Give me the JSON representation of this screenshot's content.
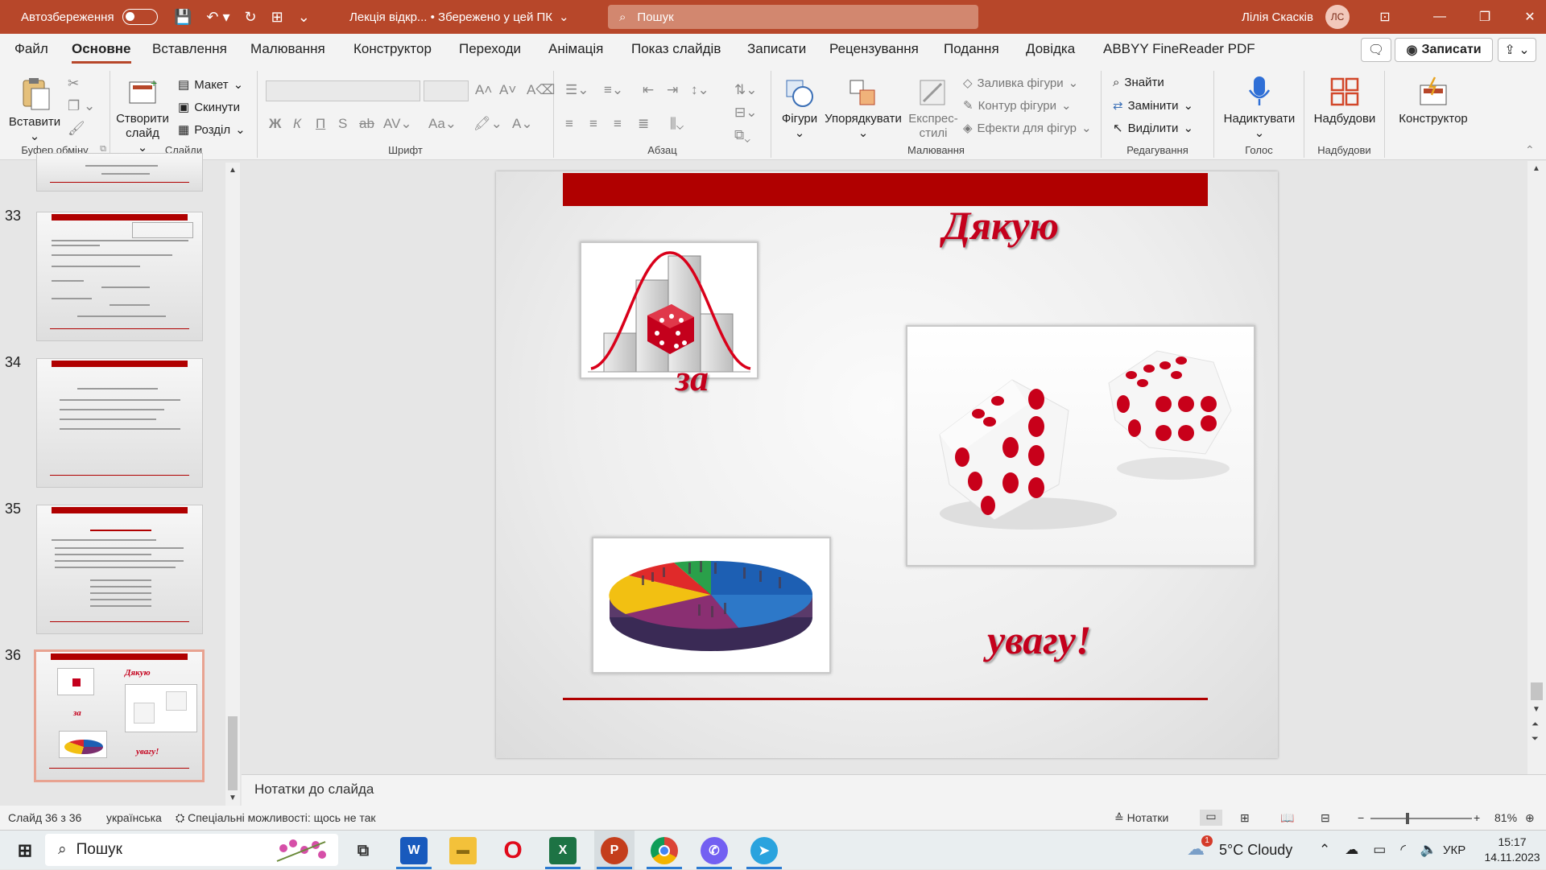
{
  "titlebar": {
    "autosave_label": "Автозбереження",
    "doc_title": "Лекція відкр... • Збережено у цей ПК",
    "search_placeholder": "Пошук",
    "user_name": "Лілія Скасків",
    "user_initials": "ЛС"
  },
  "menu": {
    "tabs": [
      "Файл",
      "Основне",
      "Вставлення",
      "Малювання",
      "Конструктор",
      "Переходи",
      "Анімація",
      "Показ слайдів",
      "Записати",
      "Рецензування",
      "Подання",
      "Довідка",
      "ABBYY FineReader PDF"
    ],
    "record_button": "Записати"
  },
  "ribbon": {
    "paste": "Вставити",
    "clipboard_group": "Буфер обміну",
    "new_slide": "Створити слайд",
    "layout": "Макет",
    "reset": "Скинути",
    "section": "Розділ",
    "slides_group": "Слайди",
    "font_group": "Шрифт",
    "paragraph_group": "Абзац",
    "shapes": "Фігури",
    "arrange": "Упорядкувати",
    "quick_styles": "Експрес-стилі",
    "shape_fill": "Заливка фігури",
    "shape_outline": "Контур фігури",
    "shape_effects": "Ефекти для фігур",
    "drawing_group": "Малювання",
    "find": "Знайти",
    "replace": "Замінити",
    "select": "Виділити",
    "editing_group": "Редагування",
    "dictate": "Надиктувати",
    "voice_group": "Голос",
    "addins": "Надбудови",
    "addins_group": "Надбудови",
    "designer": "Конструктор"
  },
  "thumbnails": {
    "numbers": [
      "33",
      "34",
      "35",
      "36"
    ],
    "slide36_words": [
      "Дякую",
      "за",
      "увагу!"
    ]
  },
  "slide": {
    "word1": "Дякую",
    "word2": "за",
    "word3": "увагу!",
    "accent_color": "#b00000",
    "text_color": "#c4001c"
  },
  "notes_placeholder": "Нотатки до слайда",
  "status": {
    "slide_counter": "Слайд 36 з 36",
    "language": "українська",
    "accessibility": "Спеціальні можливості: щось не так",
    "notes_button": "Нотатки",
    "zoom": "81%"
  },
  "taskbar": {
    "search": "Пошук",
    "weather": "5°C  Cloudy",
    "lang": "УКР",
    "time": "15:17",
    "date": "14.11.2023",
    "notification_count": "1"
  }
}
